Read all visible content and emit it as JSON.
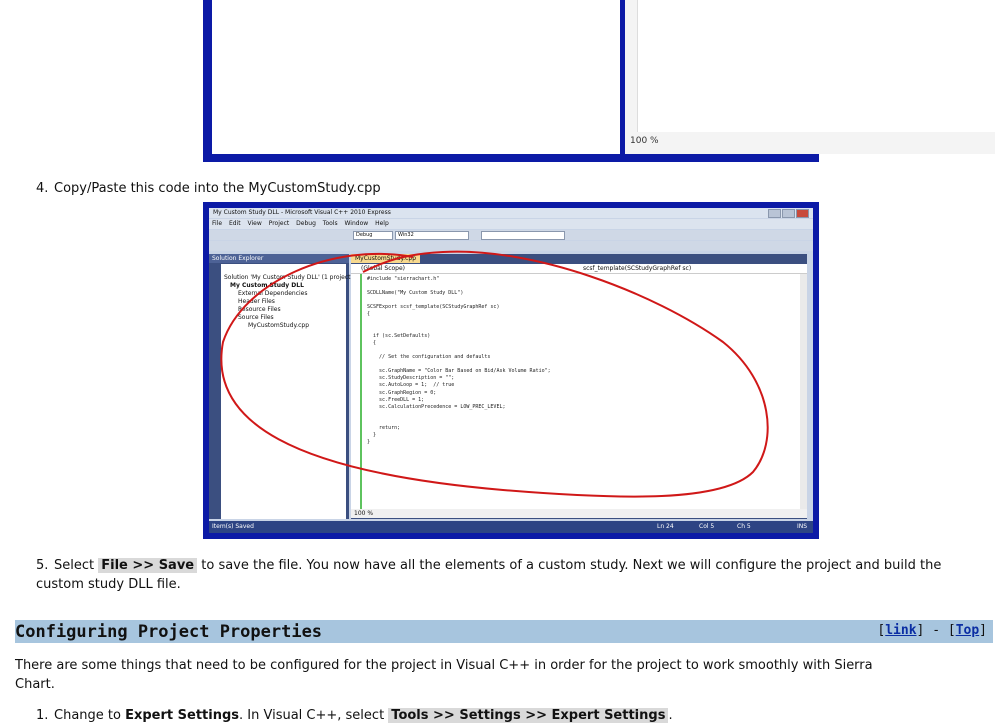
{
  "screenshot1": {
    "zoom": "100 %"
  },
  "steps": [
    {
      "num": "4.",
      "text": "Copy/Paste this code into the MyCustomStudy.cpp"
    },
    {
      "num": "5.",
      "pre": "Select ",
      "highlight": "File >> Save",
      "post": " to save the file. You now have all the elements of a custom study. Next we will configure the project and build the custom study DLL file."
    },
    {
      "num": "1.",
      "pre": "Change to ",
      "bold": "Expert Settings",
      "mid": ". In Visual C++, select ",
      "highlight": "Tools >> Settings >> Expert Settings",
      "post": "."
    }
  ],
  "vs": {
    "title": "My Custom Study DLL - Microsoft Visual C++ 2010 Express",
    "menu": [
      "File",
      "Edit",
      "View",
      "Project",
      "Debug",
      "Tools",
      "Window",
      "Help"
    ],
    "config": "Debug",
    "platform": "Win32",
    "solution_explorer": {
      "header": "Solution Explorer",
      "items": [
        "Solution 'My Custom Study DLL' (1 project)",
        "My Custom Study DLL",
        "External Dependencies",
        "Header Files",
        "Resource Files",
        "Source Files",
        "MyCustomStudy.cpp"
      ]
    },
    "editor_tab": "MyCustomStudy.cpp",
    "scope_left": "(Global Scope)",
    "scope_right": "scsf_template(SCStudyGraphRef sc)",
    "code": "#include \"sierrachart.h\"\n\nSCDLLName(\"My Custom Study DLL\")\n\nSCSFExport scsf_template(SCStudyGraphRef sc)\n{\n\n\n  if (sc.SetDefaults)\n  {\n\n    // Set the configuration and defaults\n\n    sc.GraphName = \"Color Bar Based on Bid/Ask Volume Ratio\";\n    sc.StudyDescription = \"\";\n    sc.AutoLoop = 1;  // true\n    sc.GraphRegion = 0;\n    sc.FreeDLL = 1;\n    sc.CalculationPrecedence = LOW_PREC_LEVEL;\n\n\n    return;\n  }\n}",
    "zoom": "100 %",
    "status": {
      "left": "Item(s) Saved",
      "ln": "Ln 24",
      "col": "Col 5",
      "ch": "Ch 5",
      "ins": "INS"
    }
  },
  "section": {
    "title": "Configuring Project Properties",
    "link_label": "link",
    "top_label": "Top",
    "sep": " - "
  },
  "paragraph": "There are some things that need to be configured for the project in Visual C++ in order for the project to work smoothly with Sierra Chart.",
  "colors": {
    "section_bg": "#a7c5de",
    "link": "#0b2ea3",
    "frame": "#0c1aa6",
    "annotation": "#d01818"
  }
}
